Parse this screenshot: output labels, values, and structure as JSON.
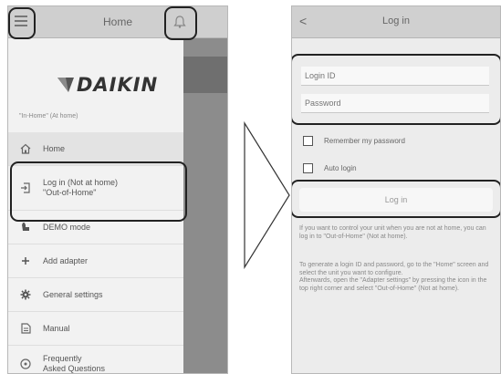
{
  "left_screen": {
    "title": "Home",
    "subtitle": "\"In-Home\" (At home)",
    "brand": "DAIKIN",
    "menu": [
      {
        "label": "Home",
        "icon": "home-icon",
        "active": true
      },
      {
        "label": "Log in (Not at home)\n\"Out-of-Home\"",
        "icon": "login-icon",
        "active": false
      },
      {
        "label": "DEMO mode",
        "icon": "demo-icon",
        "active": false
      },
      {
        "label": "Add adapter",
        "icon": "plus-icon",
        "active": false
      },
      {
        "label": "General settings",
        "icon": "gear-icon",
        "active": false
      },
      {
        "label": "Manual",
        "icon": "manual-icon",
        "active": false
      },
      {
        "label": "Frequently\nAsked Questions",
        "icon": "faq-icon",
        "active": false
      }
    ]
  },
  "right_screen": {
    "back_label": "<",
    "title": "Log in",
    "login_id_placeholder": "Login ID",
    "password_placeholder": "Password",
    "remember_label": "Remember my password",
    "auto_login_label": "Auto login",
    "login_button": "Log in",
    "para1": "If you want to control your unit when you are not at home, you can log in to \"Out-of-Home\" (Not at home).",
    "para2": "To generate a login ID and password, go to the \"Home\" screen and select the unit you want to configure.\nAfterwards, open the \"Adapter settings\" by pressing the icon in the top right corner and select \"Out-of-Home\" (Not at home)."
  },
  "colors": {
    "header": "#cfcfcf",
    "callout": "#222222",
    "drawer": "#f2f2f2"
  }
}
